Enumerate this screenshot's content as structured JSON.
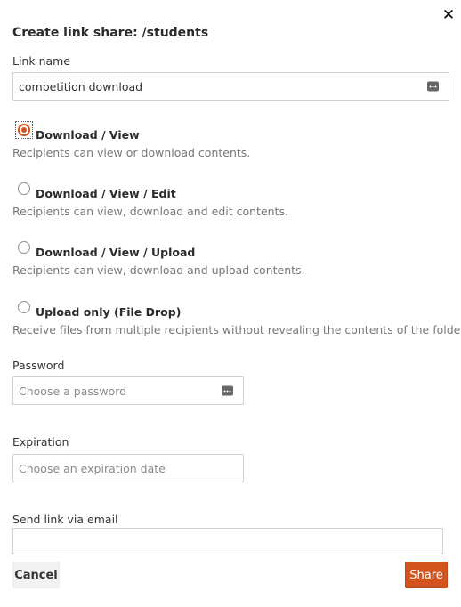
{
  "dialog": {
    "title": "Create link share: /students",
    "close_icon": "close-icon"
  },
  "link_name": {
    "label": "Link name",
    "value": "competition download",
    "icon": "keyboard-icon"
  },
  "options": [
    {
      "title": "Download / View",
      "description": "Recipients can view or download contents.",
      "selected": true
    },
    {
      "title": "Download / View / Edit",
      "description": "Recipients can view, download and edit contents.",
      "selected": false
    },
    {
      "title": "Download / View / Upload",
      "description": "Recipients can view, download and upload contents.",
      "selected": false
    },
    {
      "title": "Upload only (File Drop)",
      "description": "Receive files from multiple recipients without revealing the contents of the folder.",
      "selected": false
    }
  ],
  "password": {
    "label": "Password",
    "placeholder": "Choose a password",
    "icon": "keyboard-icon"
  },
  "expiration": {
    "label": "Expiration",
    "placeholder": "Choose an expiration date"
  },
  "email": {
    "label": "Send link via email",
    "value": ""
  },
  "buttons": {
    "cancel": "Cancel",
    "share": "Share"
  },
  "colors": {
    "accent": "#d3541f",
    "text": "#333333",
    "muted": "#777777",
    "border": "#cfcfcf"
  }
}
